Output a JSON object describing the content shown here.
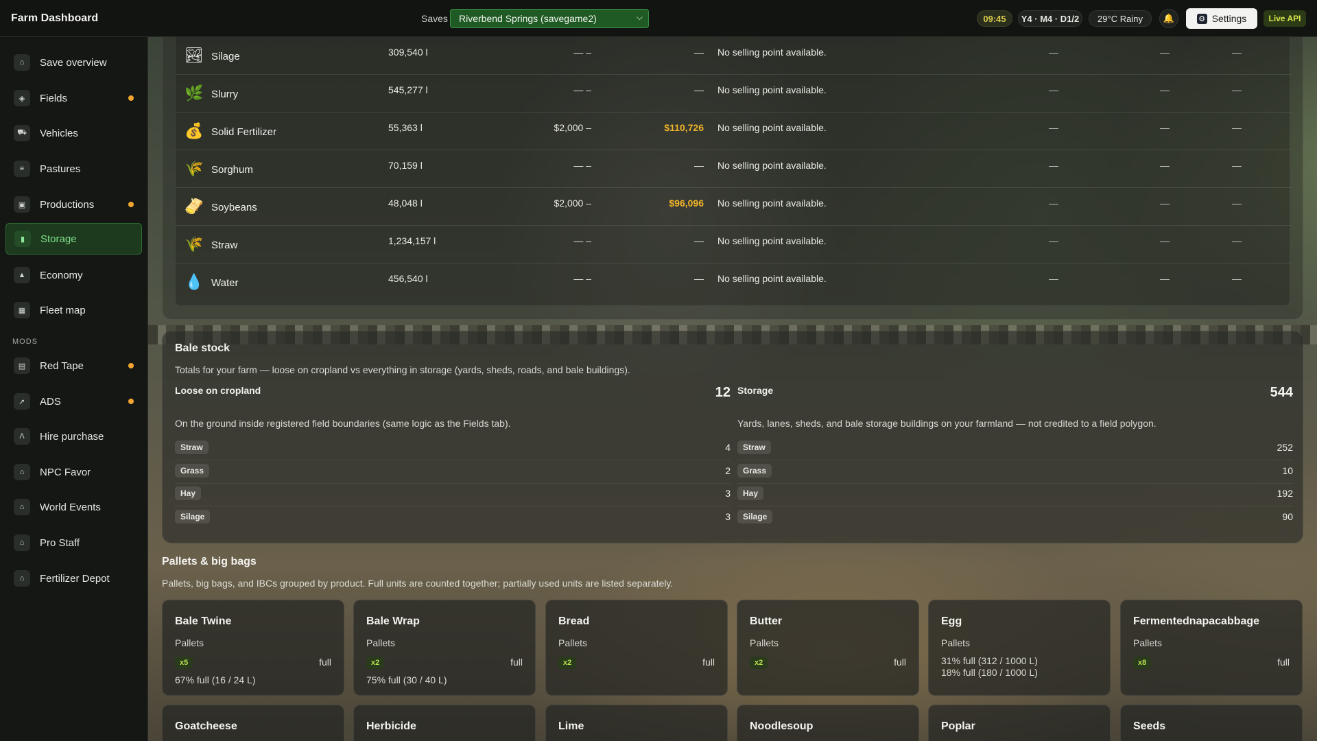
{
  "app": {
    "title": "Farm Dashboard"
  },
  "header": {
    "saves_label": "Saves",
    "save_selected": "Riverbend Springs (savegame2)",
    "time": "09:45",
    "date": "Y4 · M4 · D1/2",
    "weather": "29°C Rainy",
    "settings_label": "Settings",
    "live_api": "Live API"
  },
  "sidebar": {
    "items": [
      {
        "label": "Save overview",
        "icon": "home-icon",
        "dot": false
      },
      {
        "label": "Fields",
        "icon": "field-icon",
        "dot": true
      },
      {
        "label": "Vehicles",
        "icon": "tractor-icon",
        "dot": false
      },
      {
        "label": "Pastures",
        "icon": "fence-icon",
        "dot": false
      },
      {
        "label": "Productions",
        "icon": "factory-icon",
        "dot": true
      },
      {
        "label": "Storage",
        "icon": "silo-icon",
        "dot": false,
        "active": true
      },
      {
        "label": "Economy",
        "icon": "chart-icon",
        "dot": false
      },
      {
        "label": "Fleet map",
        "icon": "map-icon",
        "dot": false
      }
    ],
    "mods_label": "MODS",
    "mods": [
      {
        "label": "Red Tape",
        "icon": "clipboard-icon",
        "dot": true
      },
      {
        "label": "ADS",
        "icon": "route-icon",
        "dot": true
      },
      {
        "label": "Hire purchase",
        "icon": "handshake-icon",
        "dot": false
      },
      {
        "label": "NPC Favor",
        "icon": "person-icon",
        "dot": false
      },
      {
        "label": "World Events",
        "icon": "globe-icon",
        "dot": false
      },
      {
        "label": "Pro Staff",
        "icon": "staff-icon",
        "dot": false
      },
      {
        "label": "Fertilizer Depot",
        "icon": "depot-icon",
        "dot": false
      }
    ]
  },
  "storage_table": {
    "rows": [
      {
        "name": "Silage",
        "icon": "silage-icon",
        "amount": "309,540 l",
        "price": "— –",
        "value": "—",
        "selling": "No selling point available.",
        "c1": "—",
        "c2": "—",
        "c3": "—"
      },
      {
        "name": "Slurry",
        "icon": "slurry-icon",
        "amount": "545,277 l",
        "price": "— –",
        "value": "—",
        "selling": "No selling point available.",
        "c1": "—",
        "c2": "—",
        "c3": "—"
      },
      {
        "name": "Solid Fertilizer",
        "icon": "fertilizer-bag-icon",
        "amount": "55,363 l",
        "price": "$2,000 –",
        "value": "$110,726",
        "selling": "No selling point available.",
        "c1": "—",
        "c2": "—",
        "c3": "—"
      },
      {
        "name": "Sorghum",
        "icon": "sorghum-icon",
        "amount": "70,159 l",
        "price": "— –",
        "value": "—",
        "selling": "No selling point available.",
        "c1": "—",
        "c2": "—",
        "c3": "—"
      },
      {
        "name": "Soybeans",
        "icon": "soybean-icon",
        "amount": "48,048 l",
        "price": "$2,000 –",
        "value": "$96,096",
        "selling": "No selling point available.",
        "c1": "—",
        "c2": "—",
        "c3": "—"
      },
      {
        "name": "Straw",
        "icon": "straw-icon",
        "amount": "1,234,157 l",
        "price": "— –",
        "value": "—",
        "selling": "No selling point available.",
        "c1": "—",
        "c2": "—",
        "c3": "—"
      },
      {
        "name": "Water",
        "icon": "water-drop-icon",
        "amount": "456,540 l",
        "price": "— –",
        "value": "—",
        "selling": "No selling point available.",
        "c1": "—",
        "c2": "—",
        "c3": "—"
      }
    ]
  },
  "bale_stock": {
    "title": "Bale stock",
    "description": "Totals for your farm — loose on cropland vs everything in storage (yards, sheds, roads, and bale buildings).",
    "loose": {
      "title": "Loose on cropland",
      "total": "12",
      "description": "On the ground inside registered field boundaries (same logic as the Fields tab).",
      "rows": [
        {
          "label": "Straw",
          "value": "4"
        },
        {
          "label": "Grass",
          "value": "2"
        },
        {
          "label": "Hay",
          "value": "3"
        },
        {
          "label": "Silage",
          "value": "3"
        }
      ]
    },
    "storage": {
      "title": "Storage",
      "total": "544",
      "description": "Yards, lanes, sheds, and bale storage buildings on your farmland — not credited to a field polygon.",
      "rows": [
        {
          "label": "Straw",
          "value": "252"
        },
        {
          "label": "Grass",
          "value": "10"
        },
        {
          "label": "Hay",
          "value": "192"
        },
        {
          "label": "Silage",
          "value": "90"
        }
      ]
    }
  },
  "pallets": {
    "title": "Pallets & big bags",
    "description": "Pallets, big bags, and IBCs grouped by product. Full units are counted together; partially used units are listed separately.",
    "cards": [
      {
        "title": "Bale Twine",
        "sub": "Pallets",
        "badge": "x5",
        "full": "full",
        "detail": "67% full (16 / 24 L)"
      },
      {
        "title": "Bale Wrap",
        "sub": "Pallets",
        "badge": "x2",
        "full": "full",
        "detail": "75% full (30 / 40 L)"
      },
      {
        "title": "Bread",
        "sub": "Pallets",
        "badge": "x2",
        "full": "full"
      },
      {
        "title": "Butter",
        "sub": "Pallets",
        "badge": "x2",
        "full": "full"
      },
      {
        "title": "Egg",
        "sub": "Pallets",
        "detail_a": "31% full (312 / 1000 L)",
        "detail_b": "18% full (180 / 1000 L)"
      },
      {
        "title": "Fermentednapacabbage",
        "sub": "Pallets",
        "badge": "x8",
        "full": "full"
      },
      {
        "title": "Goatcheese"
      },
      {
        "title": "Herbicide"
      },
      {
        "title": "Lime"
      },
      {
        "title": "Noodlesoup"
      },
      {
        "title": "Poplar"
      },
      {
        "title": "Seeds"
      }
    ]
  }
}
